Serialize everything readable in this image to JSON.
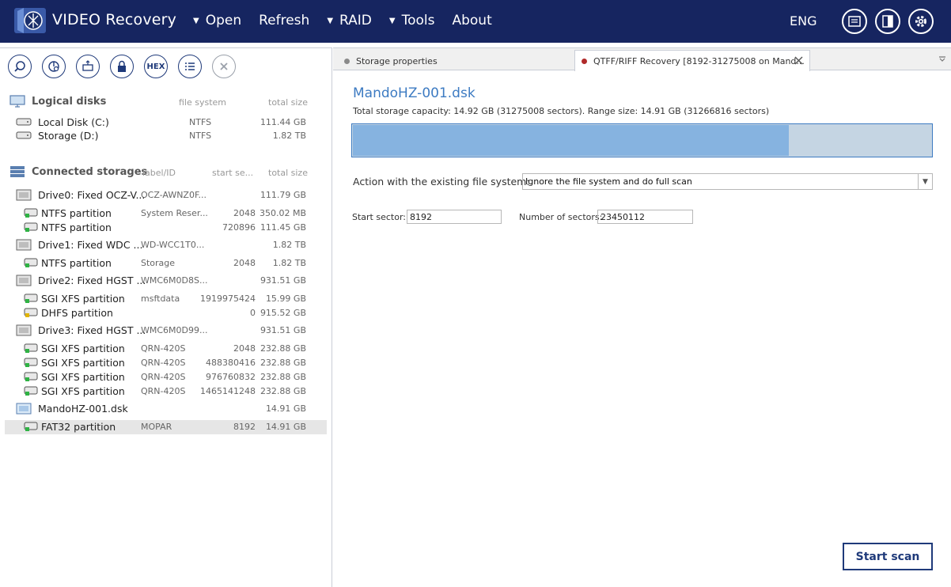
{
  "app": {
    "title": "VIDEO Recovery"
  },
  "menu": [
    {
      "label": "Open",
      "has_caret": true
    },
    {
      "label": "Refresh",
      "has_caret": false
    },
    {
      "label": "RAID",
      "has_caret": true
    },
    {
      "label": "Tools",
      "has_caret": true
    },
    {
      "label": "About",
      "has_caret": false
    }
  ],
  "lang": "ENG",
  "toolbar": {
    "hex_label": "HEX"
  },
  "logical": {
    "title": "Logical disks",
    "col_fs": "file system",
    "col_size": "total size",
    "items": [
      {
        "name": "Local Disk (C:)",
        "fs": "NTFS",
        "size": "111.44 GB"
      },
      {
        "name": "Storage (D:)",
        "fs": "NTFS",
        "size": "1.82 TB"
      }
    ]
  },
  "connected": {
    "title": "Connected storages",
    "col_label": "label/ID",
    "col_start": "start se...",
    "col_size": "total size",
    "rows": [
      {
        "name": "Drive0: Fixed OCZ-V...",
        "label": "OCZ-AWNZ0F...",
        "start": "",
        "size": "111.79 GB",
        "kind": "drive"
      },
      {
        "name": "NTFS partition",
        "label": "System Reser...",
        "start": "2048",
        "size": "350.02 MB",
        "kind": "part"
      },
      {
        "name": "NTFS partition",
        "label": "",
        "start": "720896",
        "size": "111.45 GB",
        "kind": "part"
      },
      {
        "name": "Drive1: Fixed WDC ...",
        "label": "WD-WCC1T0...",
        "start": "",
        "size": "1.82 TB",
        "kind": "drive"
      },
      {
        "name": "NTFS partition",
        "label": "Storage",
        "start": "2048",
        "size": "1.82 TB",
        "kind": "part"
      },
      {
        "name": "Drive2: Fixed HGST ...",
        "label": "WMC6M0D8S...",
        "start": "",
        "size": "931.51 GB",
        "kind": "drive"
      },
      {
        "name": "SGI XFS partition",
        "label": "msftdata",
        "start": "1919975424",
        "size": "15.99 GB",
        "kind": "part"
      },
      {
        "name": "DHFS partition",
        "label": "",
        "start": "0",
        "size": "915.52 GB",
        "kind": "part-yellow"
      },
      {
        "name": "Drive3: Fixed HGST ...",
        "label": "WMC6M0D99...",
        "start": "",
        "size": "931.51 GB",
        "kind": "drive"
      },
      {
        "name": "SGI XFS partition",
        "label": "QRN-420S",
        "start": "2048",
        "size": "232.88 GB",
        "kind": "part"
      },
      {
        "name": "SGI XFS partition",
        "label": "QRN-420S",
        "start": "488380416",
        "size": "232.88 GB",
        "kind": "part"
      },
      {
        "name": "SGI XFS partition",
        "label": "QRN-420S",
        "start": "976760832",
        "size": "232.88 GB",
        "kind": "part"
      },
      {
        "name": "SGI XFS partition",
        "label": "QRN-420S",
        "start": "1465141248",
        "size": "232.88 GB",
        "kind": "part"
      },
      {
        "name": "MandoHZ-001.dsk",
        "label": "",
        "start": "",
        "size": "14.91 GB",
        "kind": "image"
      },
      {
        "name": "FAT32 partition",
        "label": "MOPAR",
        "start": "8192",
        "size": "14.91 GB",
        "kind": "part",
        "selected": true
      }
    ]
  },
  "tabs": [
    {
      "label": "Storage properties"
    },
    {
      "label": "QTFF/RIFF Recovery [8192-31275008 on Mand..."
    }
  ],
  "main": {
    "storage_name": "MandoHZ-001.dsk",
    "capacity_text": "Total storage capacity: 14.92 GB (31275008 sectors). Range size: 14.91 GB (31266816 sectors)",
    "range_fraction": 0.7517,
    "action_label": "Action with the existing file system:",
    "action_value": "Ignore the file system and do full scan",
    "start_sector_label": "Start sector:",
    "start_sector_value": "8192",
    "num_sectors_label": "Number of sectors:",
    "num_sectors_value": "23450112",
    "start_scan_label": "Start scan"
  },
  "colors": {
    "accent": "#3d7bc2",
    "topbar": "#162560",
    "bar_fill": "#86b3e0",
    "bar_bg": "#c5d5e3"
  }
}
